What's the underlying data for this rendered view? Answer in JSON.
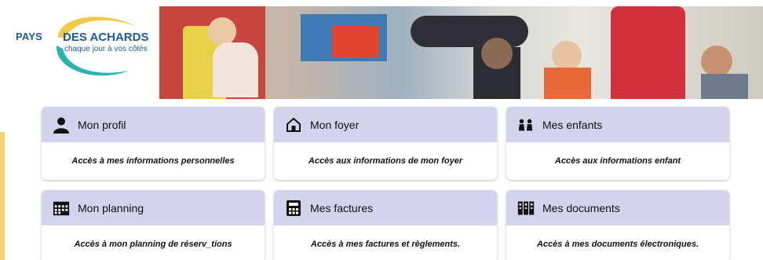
{
  "logo": {
    "pays": "PAYS",
    "title": "DES ACHARDS",
    "tagline": "chaque jour à vos côtés"
  },
  "colors": {
    "tile_header": "#d4d3ee",
    "brand_blue": "#1e5a9c",
    "brand_yellow": "#f3c94a",
    "brand_teal": "#2bb3b1"
  },
  "tiles": [
    {
      "title": "Mon profil",
      "description": "Accès à mes informations personnelles",
      "icon": "user-icon"
    },
    {
      "title": "Mon foyer",
      "description": "Accès aux informations de mon foyer",
      "icon": "house-icon"
    },
    {
      "title": "Mes enfants",
      "description": "Accès aux informations enfant",
      "icon": "children-icon"
    },
    {
      "title": "Mon planning",
      "description": "Accès à mon planning de réserv_tions",
      "icon": "calendar-icon"
    },
    {
      "title": "Mes factures",
      "description": "Accès à mes factures et règlements.",
      "icon": "calculator-icon"
    },
    {
      "title": "Mes documents",
      "description": "Accès à mes documents électroniques.",
      "icon": "documents-icon"
    }
  ]
}
